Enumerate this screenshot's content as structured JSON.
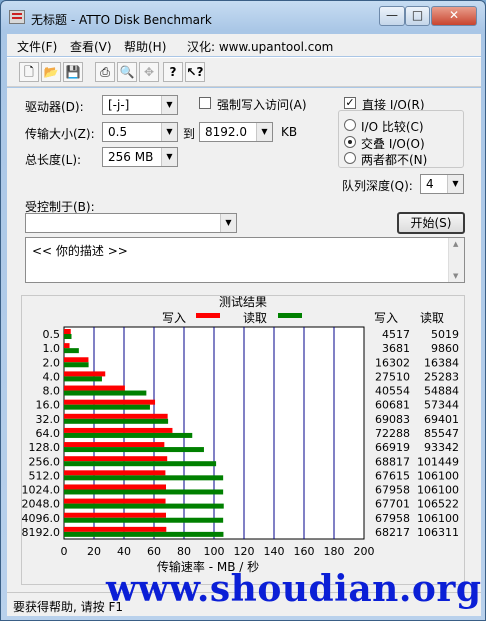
{
  "window": {
    "title": "无标题 - ATTO Disk Benchmark",
    "min": "—",
    "max": "□",
    "close": "✕"
  },
  "menu": {
    "file": "文件(F)",
    "view": "查看(V)",
    "help": "帮助(H)",
    "localized": "汉化: www.upantool.com"
  },
  "toolbar": {
    "new": "new-icon",
    "open": "open-icon",
    "save": "save-icon",
    "print": "print-icon",
    "preview": "print-preview-icon",
    "move": "move-icon",
    "help": "help-icon",
    "context_help": "context-help-icon"
  },
  "form": {
    "drive_label": "驱动器(D):",
    "drive_value": "[-j-]",
    "transfer_label": "传输大小(Z):",
    "transfer_from": "0.5",
    "transfer_to_label": "到",
    "transfer_to": "8192.0",
    "transfer_unit": "KB",
    "length_label": "总长度(L):",
    "length_value": "256 MB",
    "force_write_label": "强制写入访问(A)",
    "direct_io_label": "直接 I/O(R)",
    "io_compare": "I/O 比较(C)",
    "io_overlap": "交叠 I/O(O)",
    "io_neither": "两者都不(N)",
    "queue_label": "队列深度(Q):",
    "queue_value": "4",
    "controlled_label": "受控制于(B):",
    "controlled_value": "",
    "start_button": "开始(S)",
    "description": "<< 你的描述 >>"
  },
  "results": {
    "title": "测试结果",
    "write_label": "写入",
    "read_label": "读取",
    "col_write": "写入",
    "col_read": "读取",
    "xlabel": "传输速率 - MB / 秒",
    "write_color": "#ff0000",
    "read_color": "#008000"
  },
  "chart_data": {
    "type": "bar",
    "categories": [
      "0.5",
      "1.0",
      "2.0",
      "4.0",
      "8.0",
      "16.0",
      "32.0",
      "64.0",
      "128.0",
      "256.0",
      "512.0",
      "1024.0",
      "2048.0",
      "4096.0",
      "8192.0"
    ],
    "series": [
      {
        "name": "写入",
        "values": [
          4.5,
          3.7,
          16.3,
          27.5,
          40.6,
          60.7,
          69.1,
          72.3,
          66.9,
          68.8,
          67.6,
          68.0,
          67.7,
          68.0,
          68.2
        ]
      },
      {
        "name": "读取",
        "values": [
          5.0,
          9.9,
          16.4,
          25.3,
          54.9,
          57.3,
          69.4,
          85.5,
          93.3,
          101.4,
          106.1,
          106.1,
          106.5,
          106.1,
          106.3
        ]
      }
    ],
    "write_kbs": [
      "4517",
      "3681",
      "16302",
      "27510",
      "40554",
      "60681",
      "69083",
      "72288",
      "66919",
      "68817",
      "67615",
      "67958",
      "67701",
      "67958",
      "68217"
    ],
    "read_kbs": [
      "5019",
      "9860",
      "16384",
      "25283",
      "54884",
      "57344",
      "69401",
      "85547",
      "93342",
      "101449",
      "106100",
      "106100",
      "106522",
      "106100",
      "106311"
    ],
    "xticks": [
      "0",
      "20",
      "40",
      "60",
      "80",
      "100",
      "120",
      "140",
      "160",
      "180",
      "200"
    ],
    "xlim": [
      0,
      200
    ]
  },
  "status": {
    "text": "要获得帮助, 请按 F1"
  },
  "watermark": "www.shoudian.org"
}
